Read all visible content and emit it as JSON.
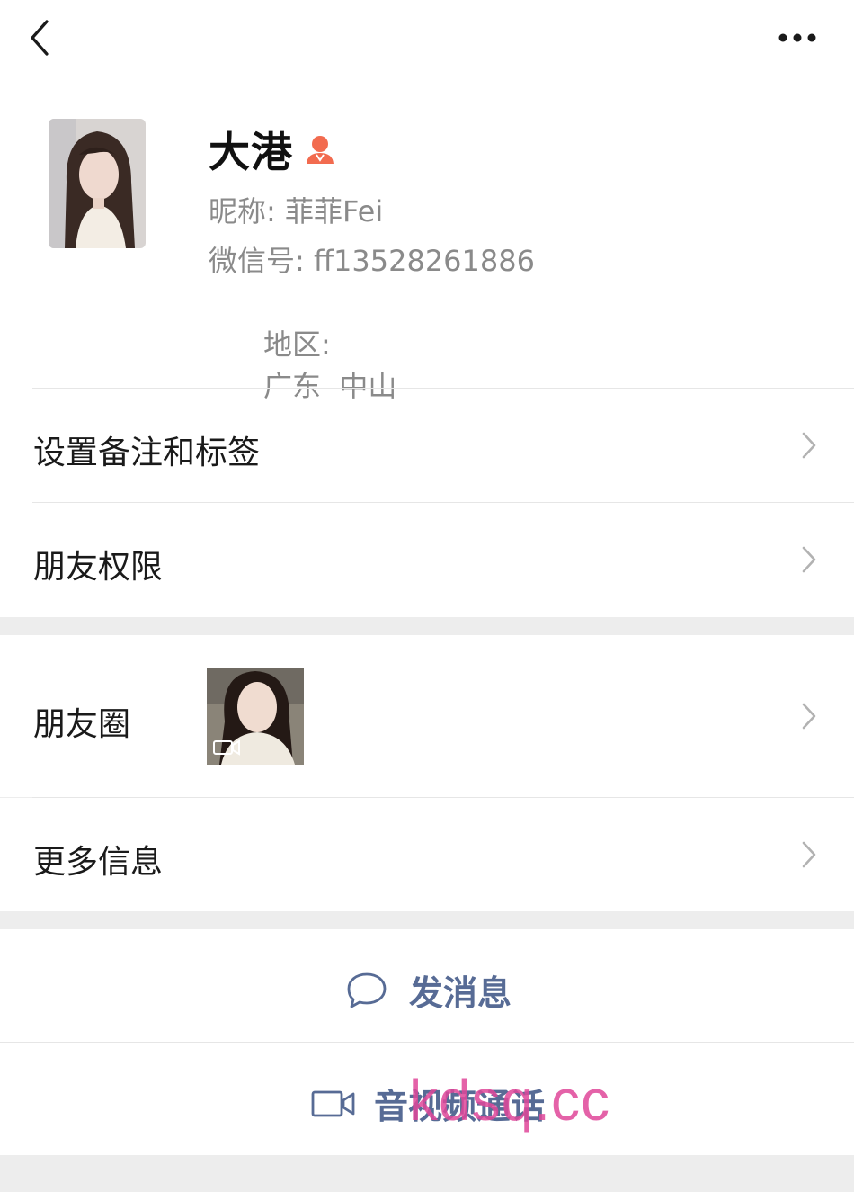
{
  "header": {
    "back_icon": "chevron-left-icon",
    "more_icon": "ellipsis-icon"
  },
  "profile": {
    "name": "大港",
    "badge_icon": "person-badge-icon",
    "badge_color": "#f26b4f",
    "nickname_label": "昵称:",
    "nickname": "菲菲Fei",
    "wechat_id_label": "微信号:",
    "wechat_id": "ff13528261886",
    "region_label": "地区:",
    "region": "广东  中山"
  },
  "menu": {
    "remark_tags": "设置备注和标签",
    "permissions": "朋友权限",
    "moments": "朋友圈",
    "more_info": "更多信息"
  },
  "actions": {
    "message": "发消息",
    "message_icon": "chat-bubble-icon",
    "call": "音视频通话",
    "call_icon": "video-camera-icon",
    "accent": "#576b95"
  },
  "watermark": "kdsq.cc"
}
